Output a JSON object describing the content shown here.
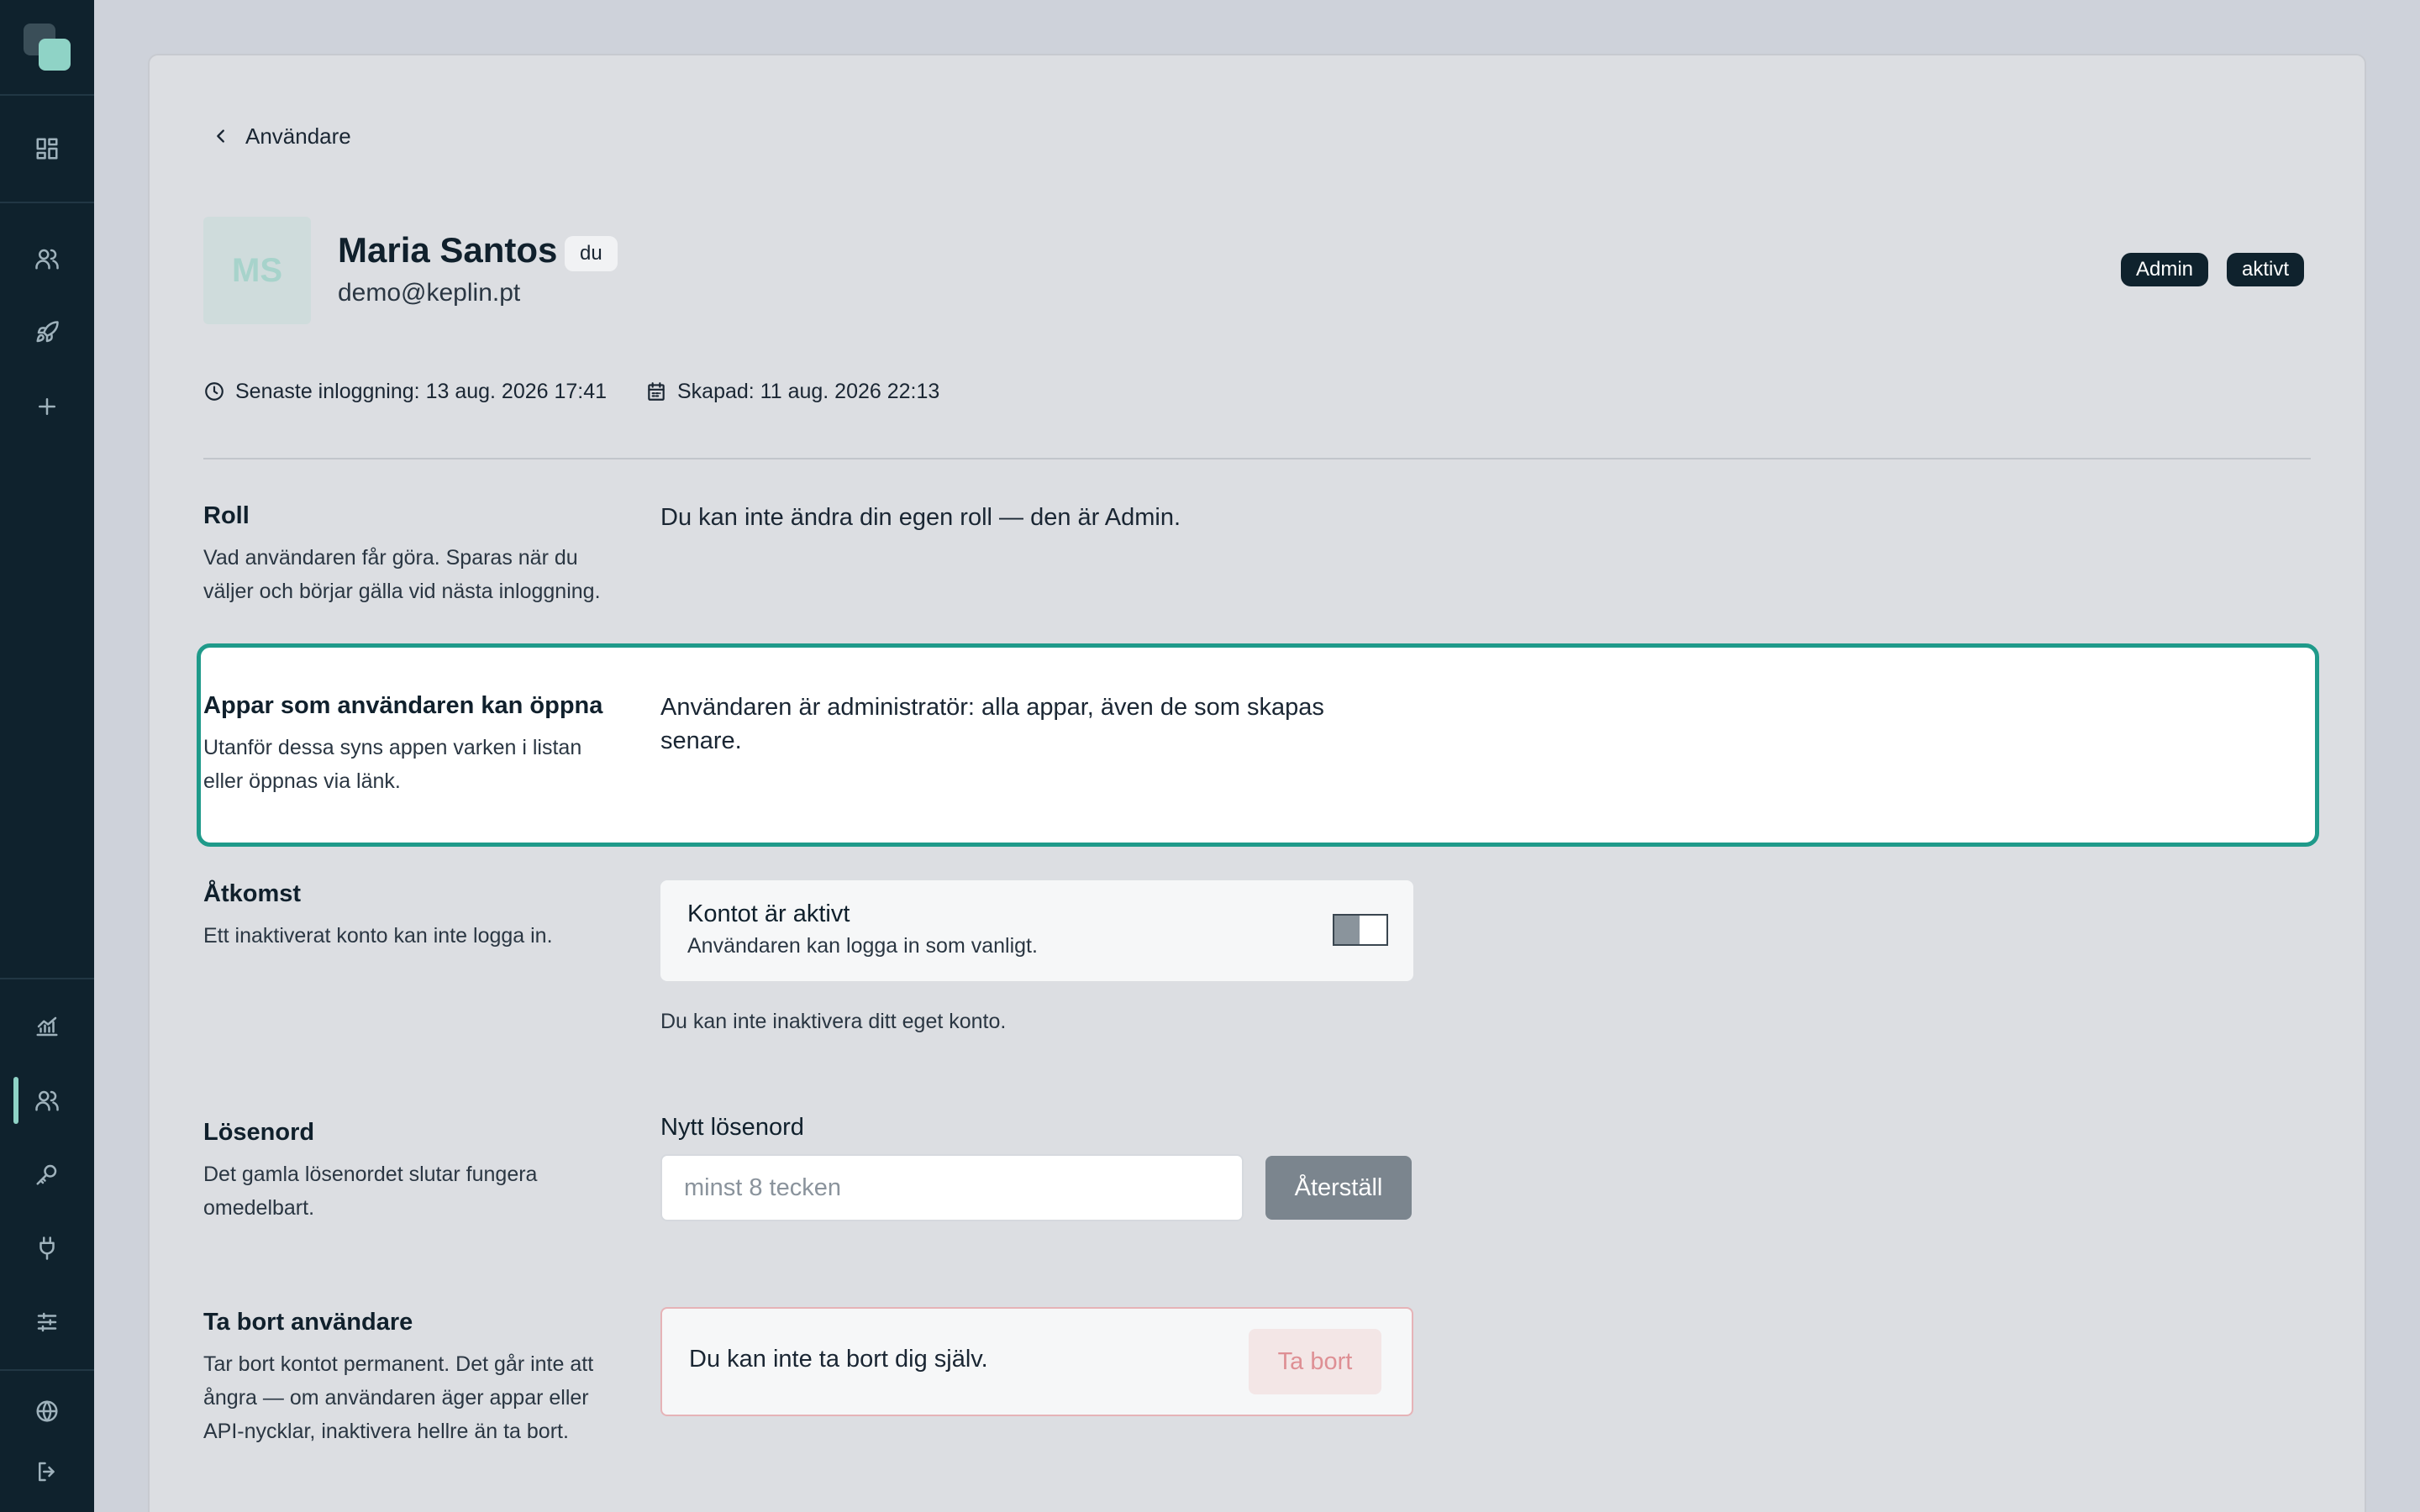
{
  "sidebar": {
    "icons": [
      "dashboard-icon",
      "users-icon",
      "rocket-icon",
      "plus-icon",
      "analytics-icon",
      "users-icon",
      "key-icon",
      "plug-icon",
      "sliders-icon",
      "globe-icon",
      "logout-icon"
    ],
    "active_item": "users",
    "accent_color": "#8fd3c6"
  },
  "breadcrumb": {
    "back_label": "Användare"
  },
  "user": {
    "initials": "MS",
    "name": "Maria Santos",
    "you_badge": "du",
    "email": "demo@keplin.pt",
    "role_badge": "Admin",
    "status_badge": "aktivt",
    "last_login": "Senaste inloggning: 13 aug. 2026 17:41",
    "created": "Skapad: 11 aug. 2026 22:13"
  },
  "sections": {
    "role": {
      "title": "Roll",
      "description": "Vad användaren får göra. Sparas när du väljer och börjar gälla vid nästa inloggning.",
      "message": "Du kan inte ändra din egen roll — den är Admin."
    },
    "apps": {
      "title": "Appar som användaren kan öppna",
      "description": "Utanför dessa syns appen varken i listan eller öppnas via länk.",
      "message": "Användaren är administratör: alla appar, även de som skapas senare."
    },
    "access": {
      "title": "Åtkomst",
      "description": "Ett inaktiverat konto kan inte logga in.",
      "toggle_title": "Kontot är aktivt",
      "toggle_subtitle": "Användaren kan logga in som vanligt.",
      "note": "Du kan inte inaktivera ditt eget konto."
    },
    "password": {
      "title": "Lösenord",
      "description": "Det gamla lösenordet slutar fungera omedelbart.",
      "field_label": "Nytt lösenord",
      "field_value": "",
      "field_placeholder": "minst 8 tecken",
      "reset_button": "Återställ"
    },
    "delete": {
      "title": "Ta bort användare",
      "description": "Tar bort kontot permanent. Det går inte att ångra — om användaren äger appar eller API-nycklar, inaktivera hellre än ta bort.",
      "message": "Du kan inte ta bort dig själv.",
      "delete_button": "Ta bort"
    }
  },
  "colors": {
    "sidebar_bg": "#0f222d",
    "focus_ring": "#1f9a8a",
    "danger_border": "#e6b3b7",
    "danger_text": "#de8f94",
    "badge_bg": "#0f222d"
  }
}
